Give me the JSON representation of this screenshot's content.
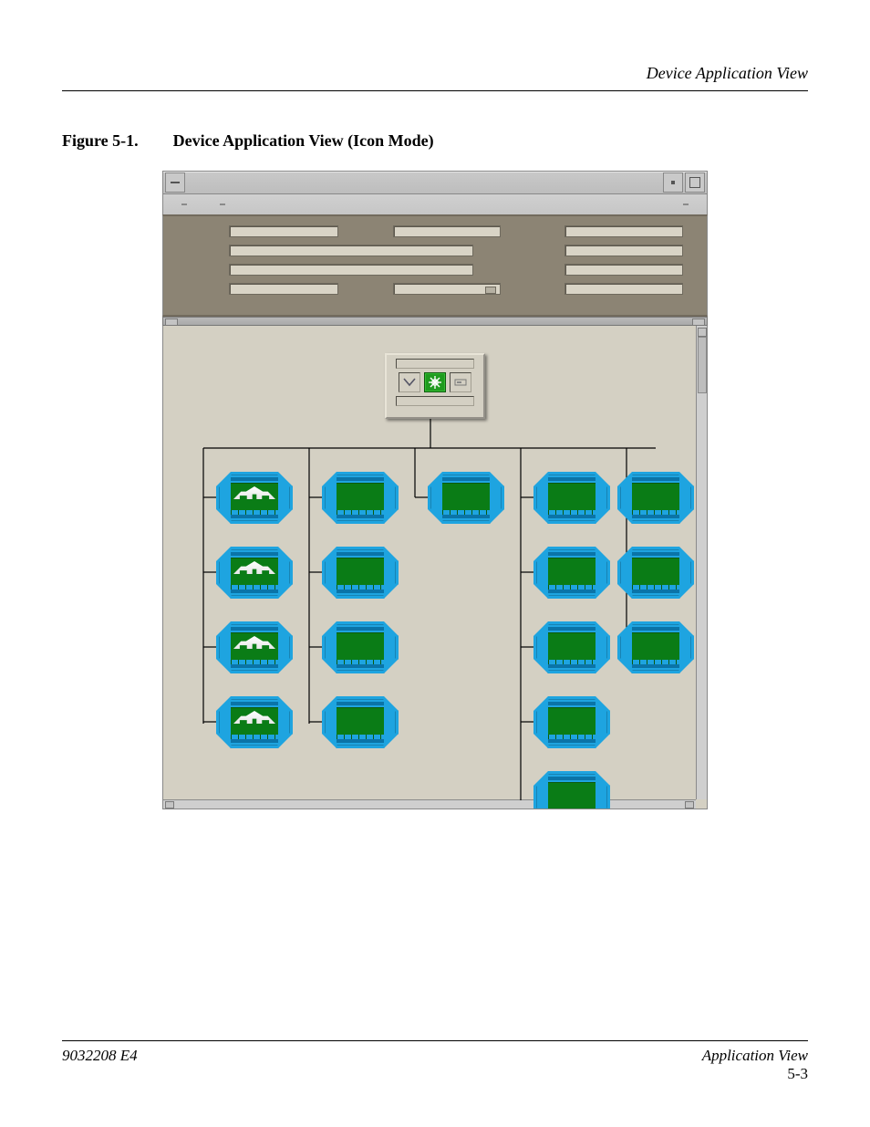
{
  "header": {
    "section_title": "Device Application View"
  },
  "figure": {
    "label": "Figure 5-1.",
    "title": "Device Application View (Icon Mode)"
  },
  "window": {
    "sysmenu_name": "system-menu",
    "minimize_name": "minimize",
    "maximize_name": "maximize"
  },
  "root_icon": {
    "chevron_name": "expand-chevron",
    "status_icon_name": "status-ok-asterisk",
    "detail_name": "detail-button"
  },
  "devices": {
    "col1": [
      "bridge",
      "bridge",
      "bridge",
      "bridge"
    ],
    "col2": [
      "plain",
      "plain",
      "plain",
      "plain"
    ],
    "col3": [
      "plain"
    ],
    "col4": [
      "plain",
      "plain",
      "plain",
      "plain",
      "plain"
    ],
    "col5": [
      "plain",
      "plain",
      "plain"
    ]
  },
  "footer": {
    "doc_id": "9032208 E4",
    "section": "Application View",
    "page": "5-3"
  }
}
